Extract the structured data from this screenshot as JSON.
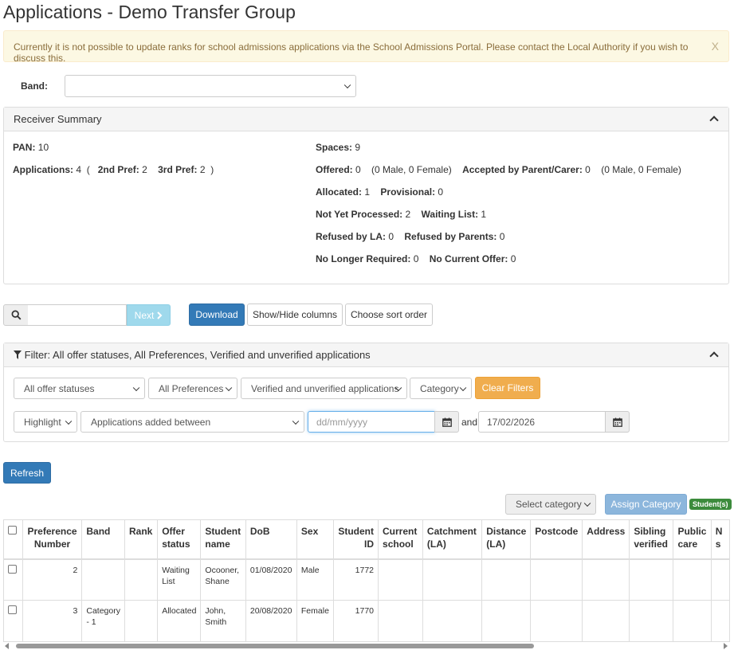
{
  "page": {
    "title": "Applications - Demo Transfer Group"
  },
  "alert": {
    "message": "Currently it is not possible to update ranks for school admissions applications via the School Admissions Portal. Please contact the Local Authority if you wish to discuss this.",
    "close": "X"
  },
  "band": {
    "label": "Band:",
    "value": ""
  },
  "summary": {
    "title": "Receiver Summary",
    "pan_label": "PAN:",
    "pan": "10",
    "applications_label": "Applications:",
    "applications": "4",
    "open_paren": "(",
    "close_paren": ")",
    "second_pref_label": "2nd Pref:",
    "second_pref": "2",
    "third_pref_label": "3rd Pref:",
    "third_pref": "2",
    "spaces_label": "Spaces:",
    "spaces": "9",
    "offered_label": "Offered:",
    "offered": "0",
    "offered_breakdown": "(0 Male, 0 Female)",
    "accepted_label": "Accepted by Parent/Carer:",
    "accepted": "0",
    "accepted_breakdown": "(0 Male, 0 Female)",
    "allocated_label": "Allocated:",
    "allocated": "1",
    "provisional_label": "Provisional:",
    "provisional": "0",
    "not_yet_label": "Not Yet Processed:",
    "not_yet": "2",
    "waiting_label": "Waiting List:",
    "waiting": "1",
    "refused_la_label": "Refused by LA:",
    "refused_la": "0",
    "refused_parents_label": "Refused by Parents:",
    "refused_parents": "0",
    "no_longer_label": "No Longer Required:",
    "no_longer": "0",
    "no_current_label": "No Current Offer:",
    "no_current": "0"
  },
  "toolbar": {
    "search_value": "",
    "next_label": "Next",
    "download_label": "Download",
    "showhide_label": "Show/Hide columns",
    "sort_label": "Choose sort order"
  },
  "filter": {
    "title": "Filter: All offer statuses, All Preferences, Verified and unverified applications",
    "offer_status": "All offer statuses",
    "preferences": "All Preferences",
    "verification": "Verified and unverified applications",
    "category": "Category",
    "clear_label": "Clear Filters",
    "highlight": "Highlight",
    "date_mode": "Applications added between",
    "from_placeholder": "dd/mm/yyyy",
    "and_label": "and",
    "to_value": "17/02/2026"
  },
  "refresh_label": "Refresh",
  "category_assign": {
    "select": "Select category",
    "assign_label": "Assign Category",
    "badge": "Student(s)"
  },
  "table": {
    "headers": [
      "",
      "Preference Number",
      "Band",
      "Rank",
      "Offer status",
      "Student name",
      "DoB",
      "Sex",
      "Student ID",
      "Current school",
      "Catchment (LA)",
      "Distance (LA)",
      "Postcode",
      "Address",
      "Sibling verified",
      "Public care",
      "N s"
    ],
    "rows": [
      [
        "",
        "2",
        "",
        "",
        "Waiting List",
        "Ocooner, Shane",
        "01/08/2020",
        "Male",
        "1772",
        "",
        "",
        "",
        "",
        "",
        "",
        "",
        ""
      ],
      [
        "",
        "3",
        "Category - 1",
        "",
        "Allocated",
        "John, Smith",
        "20/08/2020",
        "Female",
        "1770",
        "",
        "",
        "",
        "",
        "",
        "",
        "",
        ""
      ]
    ]
  },
  "colors": {
    "primary": "#337ab7",
    "warning": "#f0ad4e",
    "alert_bg": "#fcf8e3",
    "success": "#3c8b3c"
  }
}
